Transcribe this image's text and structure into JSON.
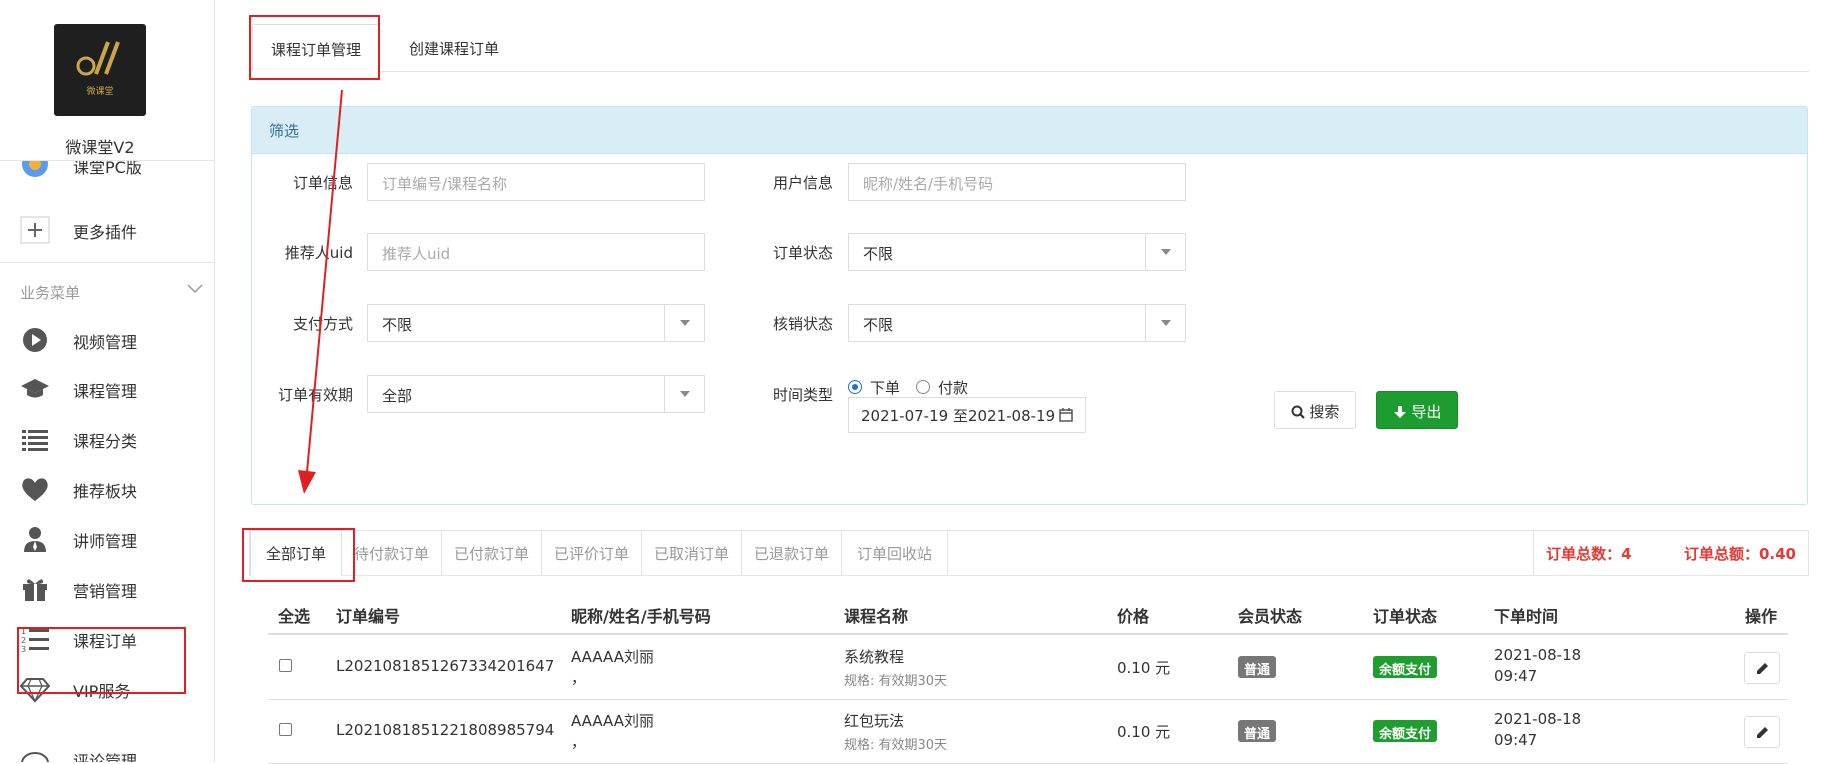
{
  "app": {
    "name": "微课堂V2",
    "logo_subtext": "微课堂"
  },
  "sidebar": {
    "partial_item": "课堂PC版",
    "more_plugins": "更多插件",
    "menu_title": "业务菜单",
    "items": [
      {
        "label": "视频管理",
        "icon": "play-circle-icon"
      },
      {
        "label": "课程管理",
        "icon": "graduation-cap-icon"
      },
      {
        "label": "课程分类",
        "icon": "list-icon"
      },
      {
        "label": "推荐板块",
        "icon": "heart-icon"
      },
      {
        "label": "讲师管理",
        "icon": "user-tie-icon"
      },
      {
        "label": "营销管理",
        "icon": "gift-icon"
      },
      {
        "label": "课程订单",
        "icon": "numbered-list-icon"
      },
      {
        "label": "VIP服务",
        "icon": "diamond-icon"
      },
      {
        "label": "评论管理",
        "icon": "comment-icon"
      }
    ]
  },
  "tabs": [
    "课程订单管理",
    "创建课程订单"
  ],
  "filter": {
    "title": "筛选",
    "order_info": {
      "label": "订单信息",
      "placeholder": "订单编号/课程名称"
    },
    "user_info": {
      "label": "用户信息",
      "placeholder": "昵称/姓名/手机号码"
    },
    "referrer": {
      "label": "推荐人uid",
      "placeholder": "推荐人uid"
    },
    "order_status": {
      "label": "订单状态",
      "value": "不限"
    },
    "pay_method": {
      "label": "支付方式",
      "value": "不限"
    },
    "verify_status": {
      "label": "核销状态",
      "value": "不限"
    },
    "validity": {
      "label": "订单有效期",
      "value": "全部"
    },
    "time_type": {
      "label": "时间类型",
      "options": [
        "下单",
        "付款"
      ],
      "selected": "下单"
    },
    "date_range": "2021-07-19 至2021-08-19",
    "search_btn": "搜索",
    "export_btn": "导出"
  },
  "status_tabs": [
    "全部订单",
    "待付款订单",
    "已付款订单",
    "已评价订单",
    "已取消订单",
    "已退款订单",
    "订单回收站"
  ],
  "summary": {
    "count_label": "订单总数：4",
    "amount_label": "订单总额：0.40"
  },
  "table": {
    "headers": [
      "全选",
      "订单编号",
      "昵称/姓名/手机号码",
      "课程名称",
      "价格",
      "会员状态",
      "订单状态",
      "下单时间",
      "操作"
    ],
    "rows": [
      {
        "order_no": "L20210818512673342016 47",
        "order_no_full": "L2021081851267334201647",
        "user": "AAAAA刘丽",
        "user_sub": "，",
        "course": "系统教程",
        "spec": "规格: 有效期30天",
        "price": "0.10 元",
        "member": "普通",
        "status": "余额支付",
        "date": "2021-08-18",
        "time": "09:47"
      },
      {
        "order_no_full": "L2021081851221808985794",
        "user": "AAAAA刘丽",
        "user_sub": "，",
        "course": "红包玩法",
        "spec": "规格: 有效期30天",
        "price": "0.10 元",
        "member": "普通",
        "status": "余额支付",
        "date": "2021-08-18",
        "time": "09:47"
      }
    ]
  },
  "colors": {
    "accent_red": "#e02020",
    "export_green": "#1d9d2f",
    "panel_head": "#d9edf7"
  }
}
